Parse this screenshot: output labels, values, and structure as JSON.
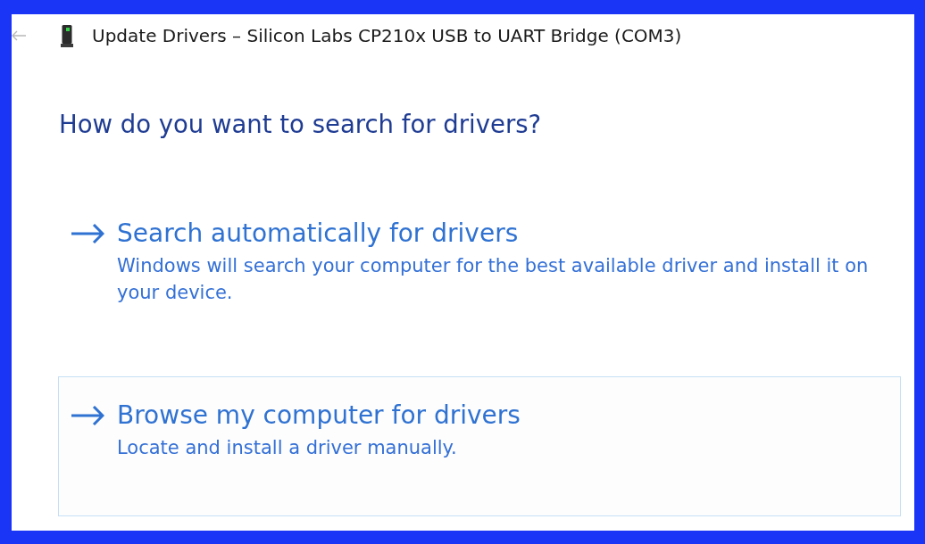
{
  "window": {
    "title": "Update Drivers – Silicon Labs CP210x USB to UART Bridge (COM3)"
  },
  "heading": "How do you want to search for drivers?",
  "options": [
    {
      "title": "Search automatically for drivers",
      "description": "Windows will search your computer for the best available driver and install it on your device.",
      "focused": false
    },
    {
      "title": "Browse my computer for drivers",
      "description": "Locate and install a driver manually.",
      "focused": true
    }
  ]
}
